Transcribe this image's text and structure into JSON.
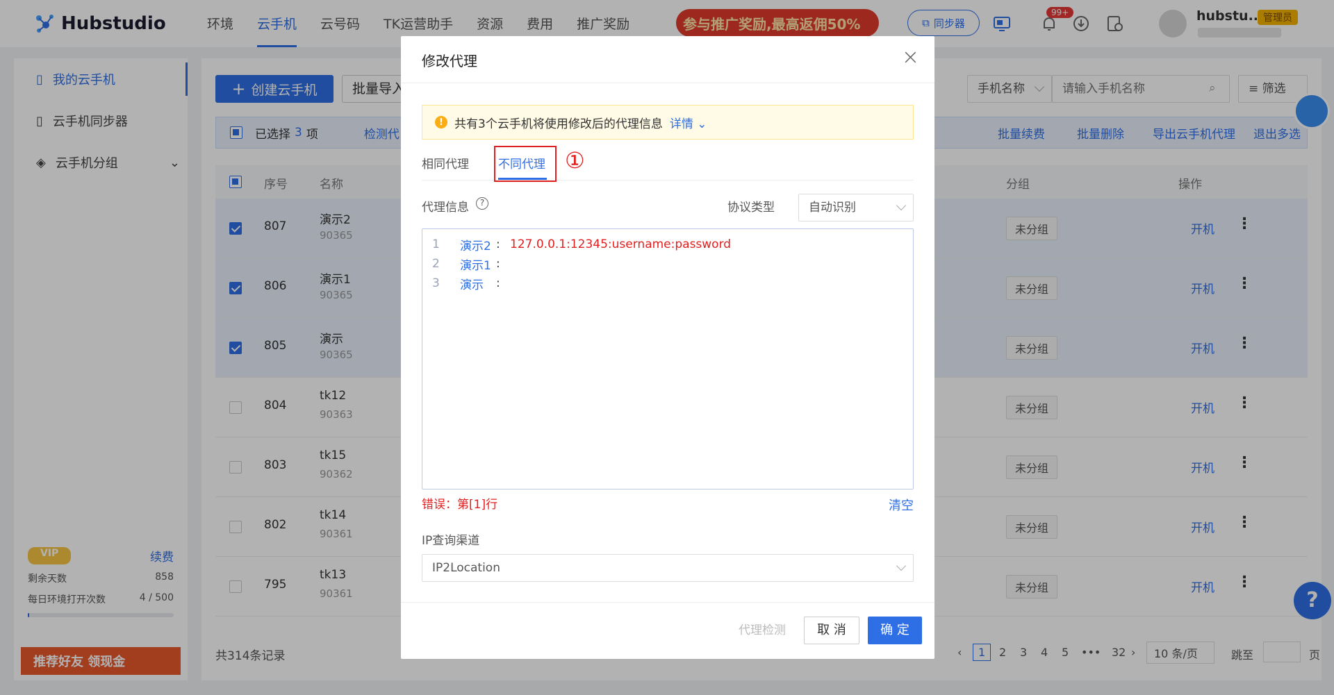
{
  "app": {
    "logo_text": "Hubstudio"
  },
  "nav": {
    "items": [
      {
        "label": "环境",
        "active": false
      },
      {
        "label": "云手机",
        "active": true
      },
      {
        "label": "云号码",
        "active": false
      },
      {
        "label": "TK运营助手",
        "active": false
      },
      {
        "label": "资源",
        "active": false
      },
      {
        "label": "费用",
        "active": false
      },
      {
        "label": "推广奖励",
        "active": false
      }
    ],
    "promo": "参与推广奖励,最高返佣50%",
    "sync_button": "同步器",
    "notification_badge": "99+",
    "user_name": "hubstu...",
    "user_role": "管理员"
  },
  "sidebar": {
    "items": [
      {
        "label": "我的云手机",
        "active": true
      },
      {
        "label": "云手机同步器",
        "active": false
      },
      {
        "label": "云手机分组",
        "active": false
      }
    ],
    "vip": {
      "badge": "VIP",
      "renew": "续费",
      "days_label": "剩余天数",
      "days_value": "858",
      "opens_label": "每日环境打开次数",
      "opens_value": "4 / 500",
      "opens_fraction": 0.008
    },
    "refer_banner": "推荐好友 领现金"
  },
  "toolbar": {
    "create_button": "创建云手机",
    "import_button": "批量导入",
    "search_field_select": "手机名称",
    "search_placeholder": "请输入手机名称",
    "filter_button": "筛选"
  },
  "selection_bar": {
    "selected_prefix": "已选择",
    "selected_count": "3",
    "selected_suffix": "项",
    "detect": "检测代",
    "actions": [
      "批量续费",
      "批量删除",
      "导出云手机代理",
      "退出多选"
    ]
  },
  "table": {
    "headers": {
      "seq": "序号",
      "name": "名称",
      "group": "分组",
      "ops": "操作"
    },
    "rows": [
      {
        "checked": true,
        "seq": "807",
        "name": "演示2",
        "sub": "90365",
        "group": "未分组",
        "action": "开机"
      },
      {
        "checked": true,
        "seq": "806",
        "name": "演示1",
        "sub": "90365",
        "group": "未分组",
        "action": "开机"
      },
      {
        "checked": true,
        "seq": "805",
        "name": "演示",
        "sub": "90365",
        "group": "未分组",
        "action": "开机"
      },
      {
        "checked": false,
        "seq": "804",
        "name": "tk12",
        "sub": "90363",
        "group": "未分组",
        "action": "开机"
      },
      {
        "checked": false,
        "seq": "803",
        "name": "tk15",
        "sub": "90362",
        "group": "未分组",
        "action": "开机"
      },
      {
        "checked": false,
        "seq": "802",
        "name": "tk14",
        "sub": "90361",
        "group": "未分组",
        "action": "开机"
      },
      {
        "checked": false,
        "seq": "795",
        "name": "tk13",
        "sub": "90361",
        "group": "未分组",
        "action": "开机"
      }
    ]
  },
  "footer": {
    "total": "共314条记录",
    "pages": [
      "1",
      "2",
      "3",
      "4",
      "5",
      "•••",
      "32"
    ],
    "per_page": "10 条/页",
    "jump_label": "跳至",
    "page_suffix": "页"
  },
  "modal": {
    "title": "修改代理",
    "alert_text": "共有3个云手机将使用修改后的代理信息",
    "alert_link": "详情",
    "tabs": [
      {
        "label": "相同代理",
        "active": false
      },
      {
        "label": "不同代理",
        "active": true
      }
    ],
    "annotation_marker": "①",
    "proxy_label": "代理信息",
    "protocol_label": "协议类型",
    "protocol_value": "自动识别",
    "editor_lines": [
      {
        "num": "1",
        "name": "演示2",
        "value": "127.0.0.1:12345:username:password"
      },
      {
        "num": "2",
        "name": "演示1",
        "value": ""
      },
      {
        "num": "3",
        "name": "演示",
        "value": ""
      }
    ],
    "error_text": "错误：第[1]行",
    "clear": "清空",
    "ip_channel_label": "IP查询渠道",
    "ip_channel_value": "IP2Location",
    "footer": {
      "detect": "代理检测",
      "cancel": "取 消",
      "confirm": "确 定"
    }
  }
}
